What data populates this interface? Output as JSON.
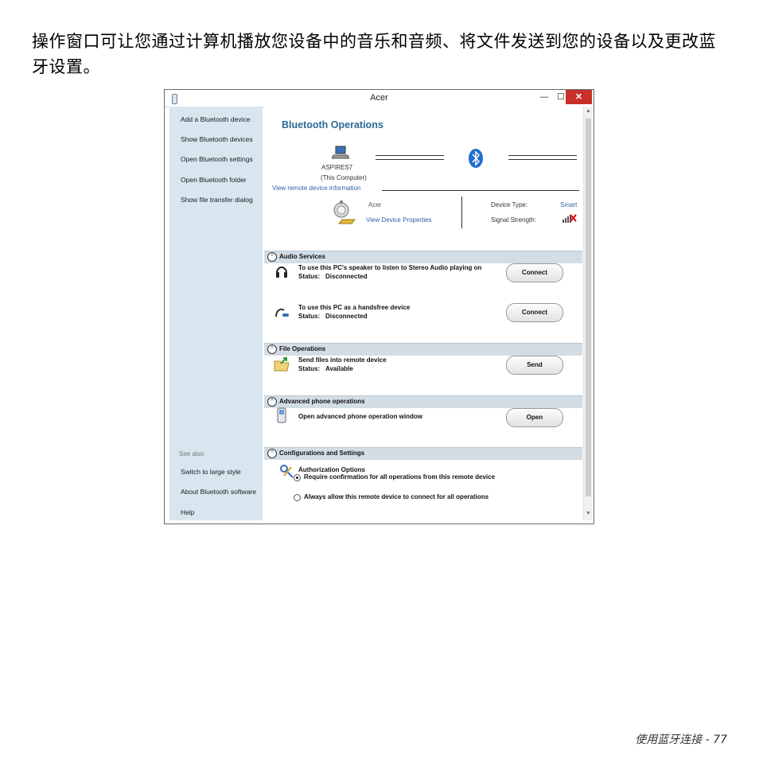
{
  "intro_text": "操作窗口可让您通过计算机播放您设备中的音乐和音频、将文件发送到您的设备以及更改蓝牙设置。",
  "footer": "使用蓝牙连接 - 77",
  "window": {
    "title": "Acer",
    "controls": {
      "minimize": "—",
      "maximize": "☐",
      "close": "✕"
    }
  },
  "sidebar": {
    "items": [
      "Add a Bluetooth device",
      "Show Bluetooth devices",
      "Open Bluetooth settings",
      "Open Bluetooth folder",
      "Show file transfer dialog"
    ],
    "see_also": "See also",
    "bottom_items": [
      "Switch to large style",
      "About Bluetooth software",
      "Help"
    ]
  },
  "ops": {
    "heading": "Bluetooth Operations",
    "computer_name": "ASPIRES7",
    "computer_sub": "(This Computer)",
    "view_remote": "View remote device information",
    "device_name": "Acer",
    "view_props": "View Device Properties",
    "device_type_label": "Device Type:",
    "device_type_value": "Smart",
    "signal_label": "Signal Strength:"
  },
  "sections": {
    "audio": {
      "label": "Audio Services",
      "rows": [
        {
          "title": "To use this PC's speaker to listen to Stereo Audio playing on",
          "status_label": "Status:",
          "status": "Disconnected",
          "button": "Connect"
        },
        {
          "title": "To use this PC as a handsfree device",
          "status_label": "Status:",
          "status": "Disconnected",
          "button": "Connect"
        }
      ]
    },
    "file": {
      "label": "File Operations",
      "title": "Send files into remote device",
      "status_label": "Status:",
      "status": "Available",
      "button": "Send"
    },
    "phone": {
      "label": "Advanced phone operations",
      "title": "Open advanced phone operation window",
      "button": "Open"
    },
    "config": {
      "label": "Configurations and Settings",
      "auth_title": "Authorization Options",
      "option1": "Require confirmation for all operations from this remote device",
      "option2": "Always allow this remote device to connect for all operations",
      "selected_option": 1
    }
  }
}
